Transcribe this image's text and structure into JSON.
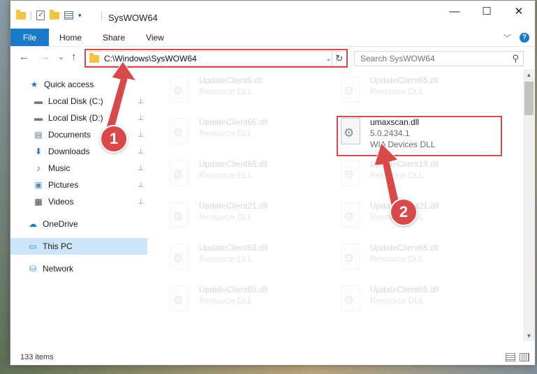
{
  "window": {
    "title": "SysWOW64",
    "controls": {
      "minimize": "—",
      "maximize": "☐",
      "close": "✕"
    }
  },
  "ribbon": {
    "tabs": [
      "File",
      "Home",
      "Share",
      "View"
    ],
    "chevron": "﹀",
    "help": "?"
  },
  "nav": {
    "back": "←",
    "forward": "→",
    "recent": "⌄",
    "up": "↑",
    "address": "C:\\Windows\\SysWOW64",
    "address_dropdown": "⌄",
    "refresh": "↻",
    "search_placeholder": "Search SysWOW64"
  },
  "sidebar": {
    "items": [
      {
        "label": "Quick access",
        "icon": "star-icon",
        "glyph": "★",
        "color": "#1979ca",
        "pinned": false
      },
      {
        "label": "Local Disk (C:)",
        "icon": "drive-icon",
        "glyph": "▬",
        "color": "#6b7b8c",
        "pinned": true
      },
      {
        "label": "Local Disk (D:)",
        "icon": "drive-icon",
        "glyph": "▬",
        "color": "#6b7b8c",
        "pinned": true
      },
      {
        "label": "Documents",
        "icon": "documents-icon",
        "glyph": "▤",
        "color": "#5a6f8c",
        "pinned": true
      },
      {
        "label": "Downloads",
        "icon": "download-icon",
        "glyph": "⬇",
        "color": "#1979ca",
        "pinned": true
      },
      {
        "label": "Music",
        "icon": "music-icon",
        "glyph": "♪",
        "color": "#1979ca",
        "pinned": true
      },
      {
        "label": "Pictures",
        "icon": "pictures-icon",
        "glyph": "▣",
        "color": "#5a8cbf",
        "pinned": true
      },
      {
        "label": "Videos",
        "icon": "videos-icon",
        "glyph": "▦",
        "color": "#444444",
        "pinned": true
      },
      {
        "label": "OneDrive",
        "icon": "cloud-icon",
        "glyph": "☁",
        "color": "#1979ca",
        "pinned": false
      },
      {
        "label": "This PC",
        "icon": "computer-icon",
        "glyph": "▭",
        "color": "#3a8ad8",
        "pinned": false,
        "selected": true
      },
      {
        "label": "Network",
        "icon": "network-icon",
        "glyph": "⛁",
        "color": "#3a8ad8",
        "pinned": false
      }
    ],
    "pin_glyph": "📌"
  },
  "files": [
    {
      "name": "UpdateClient5.dll",
      "type": "Resource DLL",
      "faded": true
    },
    {
      "name": "UpdateClient65.dll",
      "type": "Resource DLL",
      "faded": true
    },
    {
      "name": "UpdateClient65.dll",
      "type": "Resource DLL",
      "faded": true
    },
    {
      "name": "umaxscan.dll",
      "version": "5.0.2434.1",
      "type": "WIA Devices DLL",
      "faded": false,
      "highlighted": true
    },
    {
      "name": "UpdateClient65.dll",
      "type": "Resource DLL",
      "faded": true
    },
    {
      "name": "UpdateClient19.dll",
      "type": "Resource DLL",
      "faded": true
    },
    {
      "name": "UpdateClient21.dll",
      "type": "Resource DLL",
      "faded": true
    },
    {
      "name": "UpdateClient21.dll",
      "type": "Resource DLL",
      "faded": true
    },
    {
      "name": "UpdateClient63.dll",
      "type": "Resource DLL",
      "faded": true
    },
    {
      "name": "UpdateClient65.dll",
      "type": "Resource DLL",
      "faded": true
    },
    {
      "name": "UpdateClient65.dll",
      "type": "Resource DLL",
      "faded": true
    },
    {
      "name": "UpdateClient65.dll",
      "type": "Resource DLL",
      "faded": true
    }
  ],
  "status": {
    "item_count": "133 items"
  },
  "annotations": {
    "step1": "1",
    "step2": "2",
    "color": "#d9494a"
  }
}
